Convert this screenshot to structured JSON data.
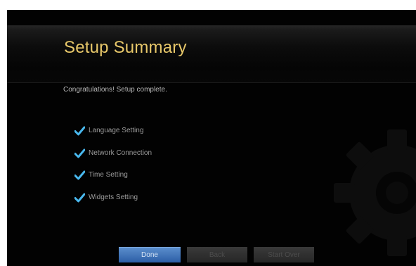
{
  "title": "Setup Summary",
  "message": "Congratulations! Setup complete.",
  "steps": [
    {
      "label": "Language Setting",
      "status": "complete"
    },
    {
      "label": "Network Connection",
      "status": "complete"
    },
    {
      "label": "Time Setting",
      "status": "complete"
    },
    {
      "label": "Widgets Setting",
      "status": "complete"
    }
  ],
  "buttons": {
    "done": "Done",
    "back": "Back",
    "start_over": "Start Over"
  },
  "colors": {
    "title": "#e8c86a",
    "check": "#49b8ee",
    "primary_button": "#3b73bd",
    "background": "#020202"
  }
}
